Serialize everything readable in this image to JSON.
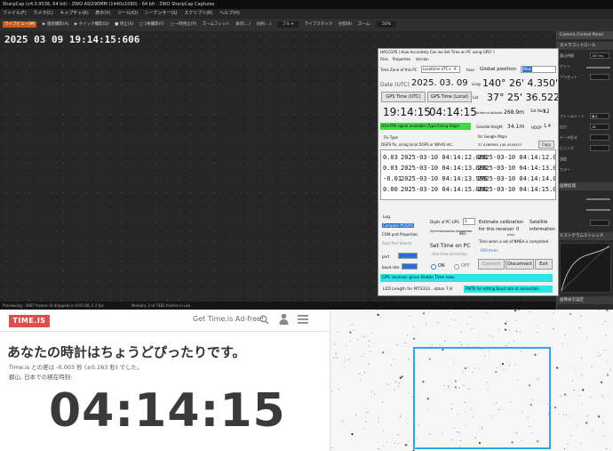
{
  "sharpcap": {
    "title": "SharpCap (v4.0.9536, 64 bit) - ZWO ASI290MM (1440x1080) - 64 bit - ZWO SharpCap Captures",
    "menu": [
      "ファイル(F)",
      "カメラ(C)",
      "キャプチャ(R)",
      "表示(V)",
      "ツール(O)",
      "シーケンサー(S)",
      "スクリプト(R)",
      "ヘルプ(H)"
    ],
    "toolbar": [
      "ライブビュー(M)",
      "▶ 連続撮影(A)",
      "▶ クイック撮影(Q)",
      "■ 停止(S)",
      "□ 1枚撮影(F)",
      "□ 一時停止(P)",
      "ズームフィット",
      "表示(...)",
      "分析(...)",
      "フル ▾",
      "ライブスタック",
      "分割(B)",
      "ズーム:",
      "50%"
    ],
    "timestamp": "2025 03 09 19:14:15:606",
    "status_frames": "Previewing : 4467 frames (0 dropped) in 0:01:08, 5.2 fps",
    "status_memory": "Memory: 2 of 7481 frames in use."
  },
  "camera_panel": {
    "title": "Camera Control Panel",
    "sections": [
      "カメラコントロール",
      "画像処理",
      "ヒストグラムストレッチ",
      "画像表示設定"
    ],
    "rows": [
      {
        "label": "露出時間",
        "value": "167 ms"
      },
      {
        "label": "ゲイン",
        "value": "300"
      },
      {
        "label": "プリセット",
        "value": ""
      },
      {
        "label": "フレームレート",
        "value": "最大"
      },
      {
        "label": "出力",
        "value": "16"
      },
      {
        "label": "データ形式",
        "value": "RAW16"
      },
      {
        "label": "ビニング",
        "value": "1x1"
      },
      {
        "label": "温度",
        "value": "32.0"
      },
      {
        "label": "カラー",
        "value": "オフ"
      }
    ]
  },
  "hacc": {
    "title": "HACCGPS ( How Accurately Can we Set Time on PC using GPS? )",
    "menu": [
      "Files",
      "Properties",
      "Version"
    ],
    "tz_label": "Time Zone of this PC",
    "tz_value": "Localtime UTC+",
    "tz_hour": "9",
    "hour_label": "hour",
    "global_pos_label": "Global position",
    "global_pos_value": "Now",
    "date_label": "Date (UTC)",
    "date_value": "2025. 03. 09",
    "long_label": "Long",
    "long_value": "140° 26' 4.350\" E",
    "gps_utc_label": "GPS Time (UTC)",
    "gps_local_label": "GPS Time (Local)",
    "lat_label": "Lat",
    "lat_value": "37° 25' 36.522\" N",
    "time_utc": "19:14:15",
    "time_local": "04:14:15",
    "alt_label": "Antenna Altitude",
    "alt_value": "268.9m",
    "sat_label": "Sat Num",
    "sat_value": "12",
    "pps_status": "OSH PPS signal available (Type Rising Edge)",
    "geoid_label": "Geoidal Height",
    "geoid_value": "34.1m",
    "hdop_label": "HDOP",
    "hdop_value": "1.4",
    "fix_type_label": "Fix Type",
    "google_maps_label": "for Google Maps",
    "fix_type_value": "DGPS fix, using local DGPS or WAAS etc.",
    "coords_value": "37.4268065,140.4345417",
    "copy_label": "Copy",
    "log_rows": [
      {
        "offset": "0.03",
        "pc": "2025-03-10 04:14:12.000",
        "gps": "2025-03-10 04:14:12.00"
      },
      {
        "offset": "0.03",
        "pc": "2025-03-10 04:14:13.000",
        "gps": "2025-03-10 04:14:13.00"
      },
      {
        "offset": "-0.01",
        "pc": "2025-03-10 04:14:13.999",
        "gps": "2025-03-10 04:14:14.00"
      },
      {
        "offset": "0.00",
        "pc": "2025-03-10 04:14:15.000",
        "gps": "2025-03-10 04:14:15.00"
      }
    ],
    "log_label": "Log",
    "compare_label": "Compare PC/GPS",
    "com_props_label": "COM port Properties",
    "auto_port_label": "Auto Port Search",
    "port_label": "port",
    "baud_label": "baud rate",
    "digits_label": "Digits of PC-GPS",
    "digits_value": "3",
    "sync_label": "Synchronization parameter",
    "sync_value": "865",
    "estimate_label": "Estimate calibration for this receiver",
    "estimate_value": "0",
    "estimate_unit": "(ms)",
    "satellite_label": "Satellite information",
    "set_time_label": "Set Time on PC",
    "one_time_label": "One time correction",
    "on_label": "ON",
    "off_label": "OFF",
    "nmea_label": "Time when a set of NMEA is completed",
    "nmea_value": "600 msec",
    "connect_label": "Connect",
    "disconnect_label": "Disconnect",
    "exit_label": "Exit",
    "receiver_status": "GPS receiver gives Stable Time now.",
    "led_label": "LED Length for MT3333 , ublox 7,8",
    "baud_hint": "RMTK for setting Baud rate at connection"
  },
  "timeis": {
    "logo": "TIME.IS",
    "ad_free": "Get Time.is Ad-free!",
    "headline": "あなたの時計はちょうどぴったりです。",
    "diff": "Time.is との差は -0.003 秒 (±0.163 秒) でした。",
    "location": "郡山, 日本での現在時刻:",
    "clock": "04:14:15",
    "accent": "#de4e4e"
  },
  "starfield": {
    "selection_color": "#2aa8e0"
  }
}
